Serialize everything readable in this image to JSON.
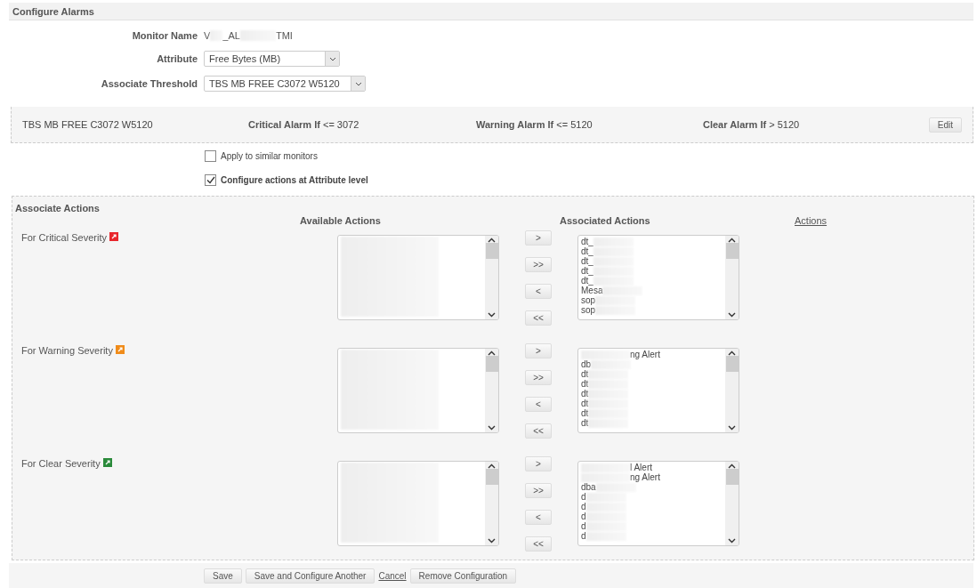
{
  "title": "Configure Alarms",
  "form": {
    "monitor_name": {
      "label": "Monitor Name",
      "fragments": [
        "V",
        "_AL",
        "TMI"
      ]
    },
    "attribute": {
      "label": "Attribute",
      "value": "Free Bytes (MB)"
    },
    "threshold": {
      "label": "Associate Threshold",
      "value": "TBS MB FREE C3072 W5120"
    }
  },
  "threshold_bar": {
    "name": "TBS MB FREE C3072 W5120",
    "critical": {
      "label": "Critical Alarm If",
      "value": "<= 3072"
    },
    "warning": {
      "label": "Warning Alarm If",
      "value": "<= 5120"
    },
    "clear": {
      "label": "Clear Alarm If",
      "value": "> 5120"
    },
    "edit": "Edit"
  },
  "options": [
    {
      "label": "Apply to similar monitors",
      "checked": false
    },
    {
      "label": "Configure actions at Attribute level",
      "checked": true
    }
  ],
  "actions": {
    "title": "Associate Actions",
    "available_heading": "Available Actions",
    "associated_heading": "Associated Actions",
    "link": "Actions",
    "rows": [
      {
        "label": "For Critical Severity",
        "color": "#e8262c",
        "move_buttons": [
          ">",
          ">>",
          "<",
          "<<"
        ],
        "associated": [
          {
            "text": "dt_",
            "kind": "head"
          },
          {
            "text": "dt_",
            "kind": "head"
          },
          {
            "text": "dt_",
            "kind": "head"
          },
          {
            "text": "dt_",
            "kind": "head"
          },
          {
            "text": "dt_",
            "kind": "head"
          },
          {
            "text": "Mesa",
            "kind": "head"
          },
          {
            "text": "sop",
            "kind": "head"
          },
          {
            "text": "sop",
            "kind": "head"
          }
        ]
      },
      {
        "label": "For Warning Severity",
        "color": "#f08c1a",
        "move_buttons": [
          ">",
          ">>",
          "<",
          "<<"
        ],
        "associated": [
          {
            "text": "ng Alert",
            "kind": "tail"
          },
          {
            "text": "db",
            "kind": "head"
          },
          {
            "text": "dt",
            "kind": "head"
          },
          {
            "text": "dt",
            "kind": "head"
          },
          {
            "text": "dt",
            "kind": "head"
          },
          {
            "text": "dt",
            "kind": "head"
          },
          {
            "text": "dt",
            "kind": "head"
          },
          {
            "text": "dt",
            "kind": "head"
          }
        ]
      },
      {
        "label": "For Clear Severity",
        "color": "#2a8a3a",
        "move_buttons": [
          ">",
          ">>",
          "<",
          "<<"
        ],
        "associated": [
          {
            "text": "l Alert",
            "kind": "tail"
          },
          {
            "text": "ng Alert",
            "kind": "tail"
          },
          {
            "text": "dba",
            "kind": "head"
          },
          {
            "text": "d",
            "kind": "head"
          },
          {
            "text": "d",
            "kind": "head"
          },
          {
            "text": "d",
            "kind": "head"
          },
          {
            "text": "d",
            "kind": "head"
          },
          {
            "text": "d",
            "kind": "head"
          }
        ]
      }
    ]
  },
  "footer": [
    {
      "kind": "button",
      "label": "Save"
    },
    {
      "kind": "button",
      "label": "Save and Configure Another"
    },
    {
      "kind": "link",
      "label": "Cancel"
    },
    {
      "kind": "button",
      "label": "Remove Configuration"
    }
  ]
}
